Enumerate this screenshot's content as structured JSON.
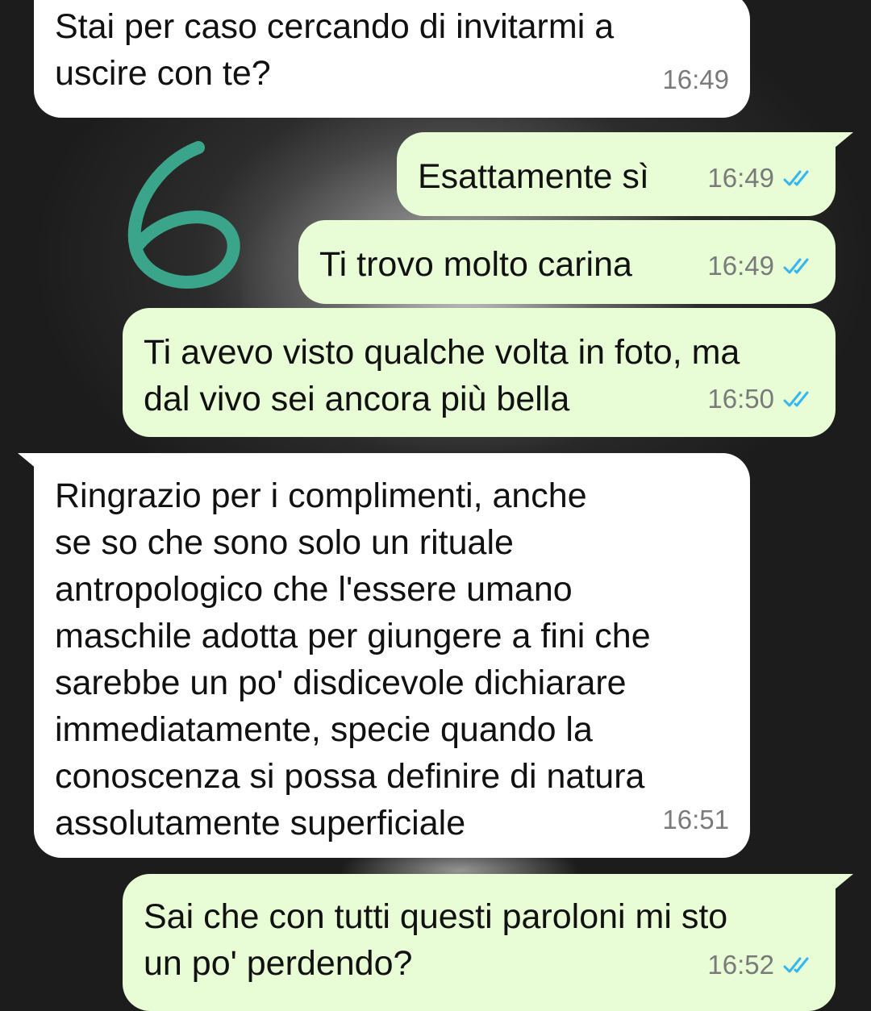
{
  "messages": [
    {
      "direction": "in",
      "text": "Stai per caso cercando di invitarmi a\nuscire con te?",
      "time": "16:49"
    },
    {
      "direction": "out",
      "text": "Esattamente sì",
      "time": "16:49",
      "status": "read"
    },
    {
      "direction": "out",
      "text": "Ti trovo molto carina",
      "time": "16:49",
      "status": "read"
    },
    {
      "direction": "out",
      "text": "Ti avevo visto qualche volta in foto, ma\ndal vivo sei ancora più bella",
      "time": "16:50",
      "status": "read"
    },
    {
      "direction": "in",
      "text": "Ringrazio per i complimenti, anche\nse so che sono solo un rituale\nantropologico che l'essere umano\nmaschile adotta per giungere a fini che\nsarebbe un po' disdicevole dichiarare\nimmediatamente, specie quando la\nconoscenza si possa definire di natura\nassolutamente superficiale",
      "time": "16:51"
    },
    {
      "direction": "out",
      "text": "Sai che con tutti questi paroloni mi sto\nun po' perdendo?",
      "time": "16:52",
      "status": "read"
    }
  ],
  "annotation": {
    "mark": "6",
    "color": "#3aa58a"
  },
  "colors": {
    "incoming_bubble": "#ffffff",
    "outgoing_bubble": "#e8fcd6",
    "read_check": "#34b7f1",
    "time": "#7a7a7a"
  },
  "icons": {
    "read_receipt": "double-check-icon"
  }
}
